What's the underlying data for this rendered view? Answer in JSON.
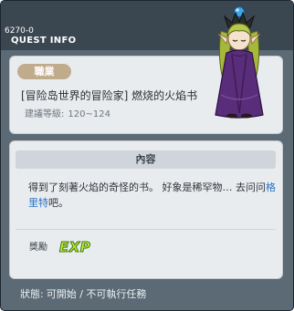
{
  "header": {
    "quest_id": "6270-0",
    "title": "QUEST INFO"
  },
  "summary": {
    "job_label": "職業",
    "quest_name": "[冒险岛世界的冒险家] 燃烧的火焰书",
    "level_label": "建議等級:",
    "level_range": "120~124"
  },
  "content": {
    "header": "內容",
    "desc_part1": "得到了刻著火焰的奇怪的书。 好象是稀罕物… 去问问",
    "npc_name": "格里特",
    "desc_part2": "吧。",
    "reward_label": "獎勵",
    "reward_icon_text": "EXP"
  },
  "status": {
    "label": "狀態:",
    "value": "可開始 / 不可執行任務"
  },
  "colors": {
    "frame": "#5c6a75",
    "titlebar": "#3a4650",
    "panel": "#e9ecee",
    "job_tag": "#c1ab8d",
    "npc_link": "#2a72c8",
    "exp_fill": "#c4ec2e"
  },
  "icons": {
    "npc": "npc-robed-figure-icon",
    "exp": "exp-reward-icon"
  }
}
